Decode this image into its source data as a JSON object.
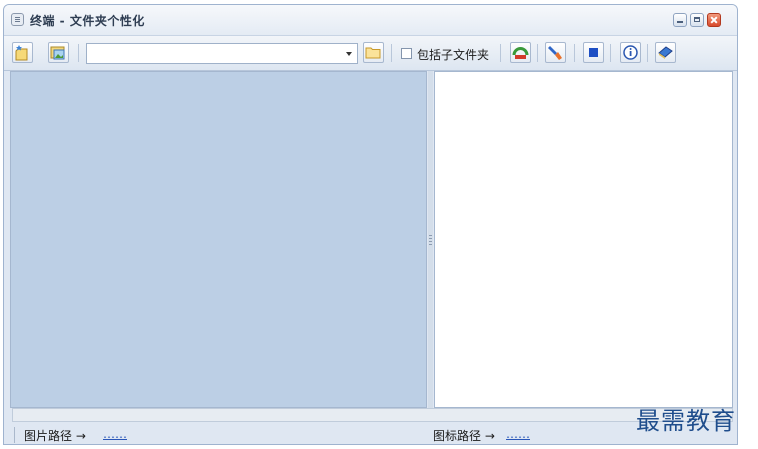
{
  "window": {
    "title": "终端 - 文件夹个性化"
  },
  "toolbar": {
    "path_value": "",
    "include_subfolders_label": "包括子文件夹",
    "include_subfolders_checked": false
  },
  "status": {
    "image_path_label": "图片路径 →",
    "image_path_value": "……",
    "icon_path_label": "图标路径 →",
    "icon_path_value": "……"
  },
  "watermark": "最需教育",
  "colors": {
    "left_pane": "#bccfe5",
    "link": "#2855b8",
    "watermark": "#1f4d8c"
  }
}
